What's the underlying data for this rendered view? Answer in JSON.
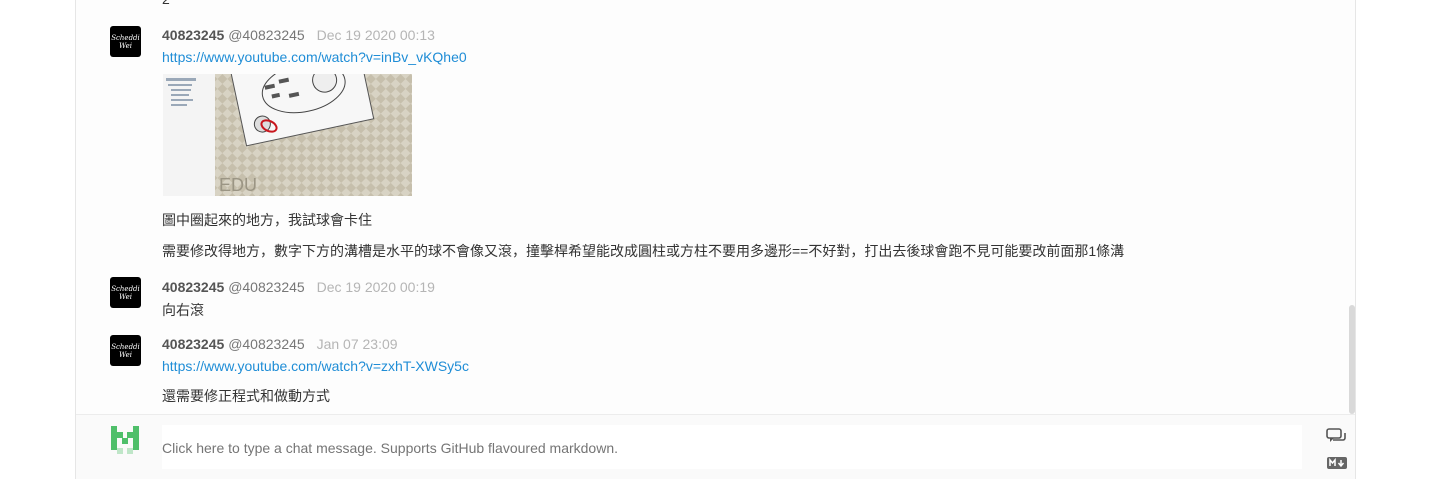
{
  "previous_message_tail": "2",
  "messages": [
    {
      "avatar_text_line1": "Scheddi",
      "avatar_text_line2": "Wei",
      "name": "40823245",
      "handle": "@40823245",
      "time": "Dec 19 2020 00:13",
      "link": "https://www.youtube.com/watch?v=inBv_vKQhe0",
      "thumbnail_caption": "EDU",
      "lines": [
        "圖中圈起來的地方，我試球會卡住",
        "需要修改得地方，數字下方的溝槽是水平的球不會像又滾，撞擊桿希望能改成圓柱或方柱不要用多邊形==不好對，打出去後球會跑不見可能要改前面那1條溝"
      ]
    },
    {
      "avatar_text_line1": "Scheddi",
      "avatar_text_line2": "Wei",
      "name": "40823245",
      "handle": "@40823245",
      "time": "Dec 19 2020 00:19",
      "lines": [
        "向右滾"
      ]
    },
    {
      "avatar_text_line1": "Scheddi",
      "avatar_text_line2": "Wei",
      "name": "40823245",
      "handle": "@40823245",
      "time": "Jan 07 23:09",
      "link": "https://www.youtube.com/watch?v=zxhT-XWSy5c",
      "lines": [
        "還需要修正程式和做動方式"
      ]
    }
  ],
  "composer": {
    "placeholder": "Click here to type a chat message. Supports GitHub flavoured markdown.",
    "chat_icon": "chat-bubbles-icon",
    "markdown_icon": "markdown-icon"
  },
  "colors": {
    "link": "#1f8dd6",
    "composer_avatar": "#4fbf6a"
  }
}
